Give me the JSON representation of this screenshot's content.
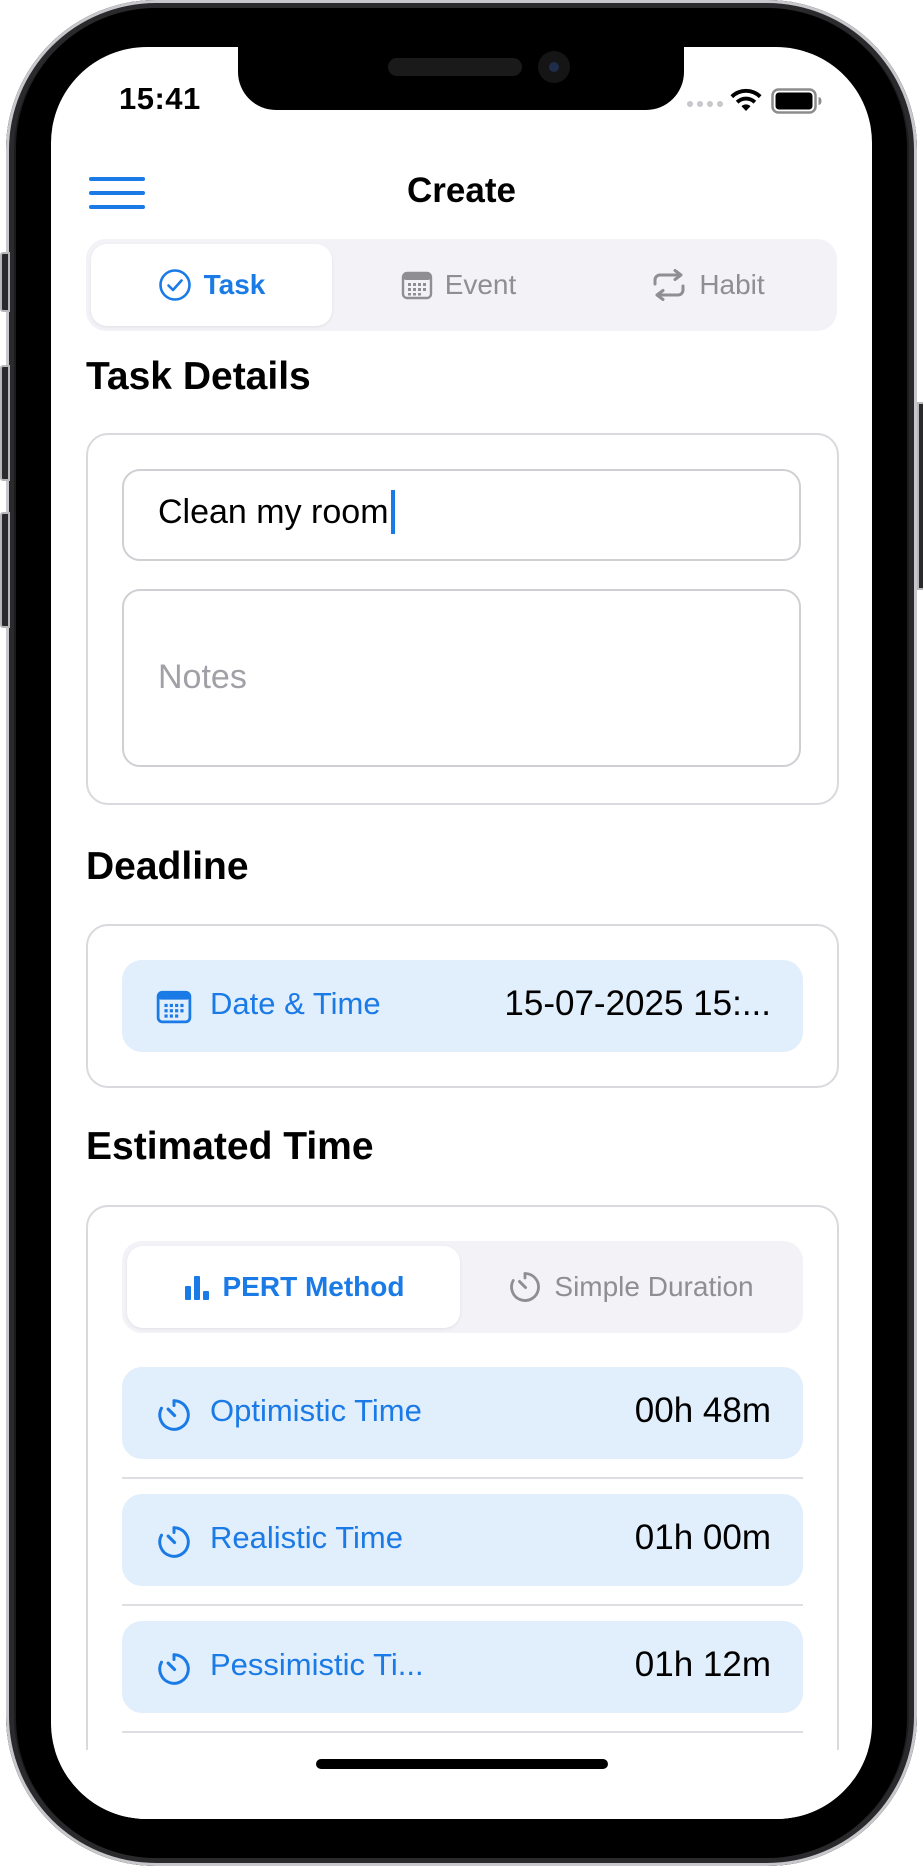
{
  "status_bar": {
    "time": "15:41"
  },
  "nav": {
    "title": "Create"
  },
  "create_tabs": [
    {
      "label": "Task",
      "icon": "checkmark-circle-icon",
      "active": true
    },
    {
      "label": "Event",
      "icon": "calendar-icon",
      "active": false
    },
    {
      "label": "Habit",
      "icon": "repeat-icon",
      "active": false
    }
  ],
  "task_details": {
    "title": "Task Details",
    "name_value": "Clean my room",
    "notes_placeholder": "Notes"
  },
  "deadline": {
    "title": "Deadline",
    "label": "Date & Time",
    "value": "15-07-2025 15:..."
  },
  "estimated_time": {
    "title": "Estimated Time",
    "methods": [
      {
        "label": "PERT Method",
        "icon": "bar-chart-icon",
        "active": true
      },
      {
        "label": "Simple Duration",
        "icon": "timer-icon",
        "active": false
      }
    ],
    "rows": [
      {
        "label": "Optimistic Time",
        "value": "00h 48m",
        "icon": "timer-icon"
      },
      {
        "label": "Realistic Time",
        "value": "01h 00m",
        "icon": "timer-icon"
      },
      {
        "label": "Pessimistic Ti...",
        "value": "01h 12m",
        "icon": "timer-icon"
      }
    ]
  },
  "colors": {
    "accent": "#1a7ae6",
    "pill_background": "#e1eefb",
    "segment_background": "#f2f2f7"
  }
}
